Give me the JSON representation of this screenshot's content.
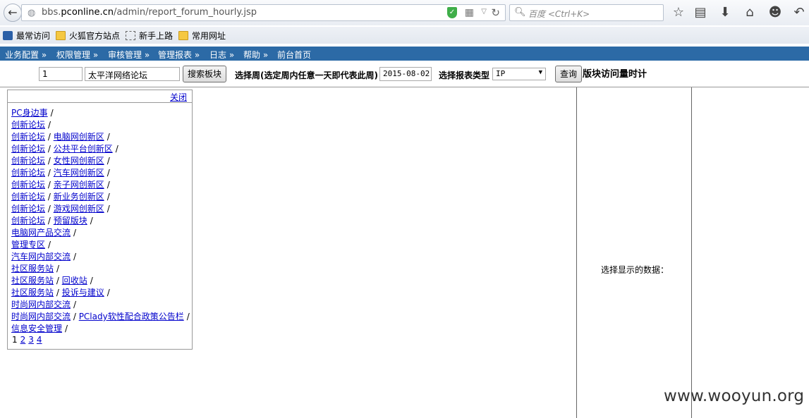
{
  "browser": {
    "url_prefix": "bbs.",
    "url_domain": "pconline.cn",
    "url_path": "/admin/report_forum_hourly.jsp",
    "search_placeholder": "百度 <Ctrl+K>"
  },
  "bookmarks": [
    {
      "label": "最常访问",
      "icon": "search-icon"
    },
    {
      "label": "火狐官方站点",
      "icon": "folder-icon"
    },
    {
      "label": "新手上路",
      "icon": "dashed-box-icon"
    },
    {
      "label": "常用网址",
      "icon": "folder-icon"
    }
  ],
  "menu": [
    {
      "label": "业务配置 »"
    },
    {
      "label": "权限管理 »"
    },
    {
      "label": "审核管理 »"
    },
    {
      "label": "管理报表 »"
    },
    {
      "label": "日志 »"
    },
    {
      "label": "帮助 »"
    },
    {
      "label": "前台首页"
    }
  ],
  "form": {
    "forum_id": "1",
    "forum_name": "太平洋网络论坛",
    "search_button": "搜索板块",
    "week_label": "选择周(选定周内任意一天即代表此周)",
    "week_value": "2015-08-02",
    "report_type_label": "选择报表类型",
    "report_type_value": "IP",
    "query_button": "查询",
    "page_title": "版块访问量时计"
  },
  "panel": {
    "close_label": "关闭",
    "items": [
      {
        "parent": "PC身边事",
        "child": ""
      },
      {
        "parent": "创新论坛",
        "child": ""
      },
      {
        "parent": "创新论坛",
        "child": "电脑网创新区"
      },
      {
        "parent": "创新论坛",
        "child": "公共平台创新区"
      },
      {
        "parent": "创新论坛",
        "child": "女性网创新区"
      },
      {
        "parent": "创新论坛",
        "child": "汽车网创新区"
      },
      {
        "parent": "创新论坛",
        "child": "亲子网创新区"
      },
      {
        "parent": "创新论坛",
        "child": "新业务创新区"
      },
      {
        "parent": "创新论坛",
        "child": "游戏网创新区"
      },
      {
        "parent": "创新论坛",
        "child": "预留版块"
      },
      {
        "parent": "电脑网产品交流",
        "child": ""
      },
      {
        "parent": "管理专区",
        "child": ""
      },
      {
        "parent": "汽车网内部交流",
        "child": ""
      },
      {
        "parent": "社区服务站",
        "child": ""
      },
      {
        "parent": "社区服务站",
        "child": "回收站"
      },
      {
        "parent": "社区服务站",
        "child": "投诉与建议"
      },
      {
        "parent": "时尚网内部交流",
        "child": ""
      },
      {
        "parent": "时尚网内部交流",
        "child": "PClady软性配合政策公告栏"
      },
      {
        "parent": "信息安全管理",
        "child": ""
      }
    ],
    "separator": "/",
    "pages": [
      "1",
      "2",
      "3",
      "4"
    ]
  },
  "right_label": "选择显示的数据：",
  "watermark": "www.wooyun.org"
}
